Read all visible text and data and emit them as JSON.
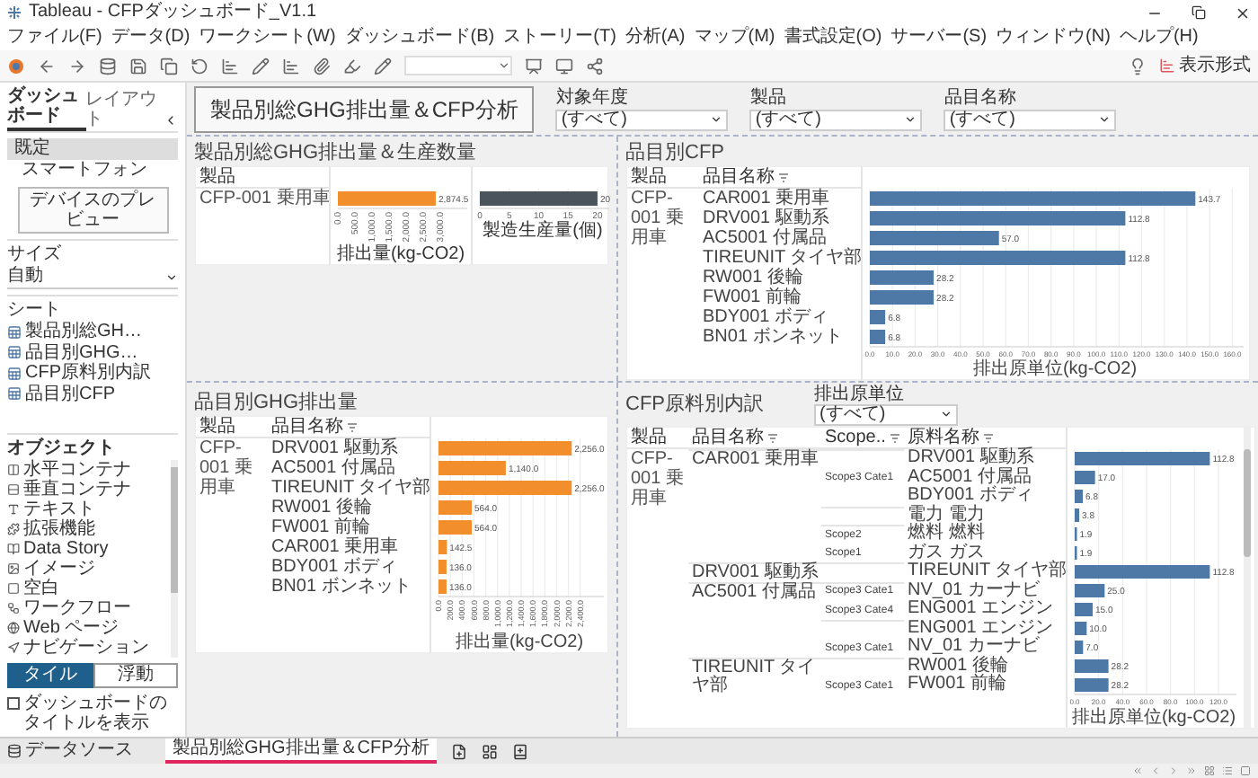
{
  "window": {
    "title": "Tableau - CFPダッシュボード_V1.1"
  },
  "menu": [
    "ファイル(F)",
    "データ(D)",
    "ワークシート(W)",
    "ダッシュボード(B)",
    "ストーリー(T)",
    "分析(A)",
    "マップ(M)",
    "書式設定(O)",
    "サーバー(S)",
    "ウィンドウ(N)",
    "ヘルプ(H)"
  ],
  "toolbar": {
    "format_button": "表示形式"
  },
  "left_panel": {
    "tabs": [
      {
        "label": "ダッシュボード",
        "selected": true
      },
      {
        "label": "レイアウト",
        "selected": false
      }
    ],
    "devices": [
      {
        "label": "既定",
        "selected": true
      },
      {
        "label": "スマートフォン",
        "selected": false
      }
    ],
    "preview_button": "デバイスのプレビュー",
    "size": {
      "title": "サイズ",
      "value": "自動"
    },
    "sheets": {
      "title": "シート",
      "items": [
        "製品別総GH…",
        "品目別GHG…",
        "CFP原料別内訳",
        "品目別CFP"
      ]
    },
    "objects": {
      "title": "オブジェクト",
      "items": [
        "水平コンテナ",
        "垂直コンテナ",
        "テキスト",
        "拡張機能",
        "Data Story",
        "イメージ",
        "空白",
        "ワークフロー",
        "Web ページ",
        "ナビゲーション"
      ]
    },
    "layout_mode": [
      {
        "label": "タイル",
        "selected": true
      },
      {
        "label": "浮動",
        "selected": false
      }
    ],
    "show_title": {
      "label": "ダッシュボードのタイトルを表示",
      "checked": false
    }
  },
  "dashboard": {
    "title": "製品別総GHG排出量＆CFP分析",
    "filters": [
      {
        "label": "対象年度",
        "value": "(すべて)"
      },
      {
        "label": "製品",
        "value": "(すべて)"
      },
      {
        "label": "品目名称",
        "value": "(すべて)"
      }
    ]
  },
  "product_ghg": {
    "title": "製品別総GHG排出量＆生産数量",
    "columns": [
      "製品"
    ],
    "emissions": {
      "chart_data": {
        "type": "bar",
        "orientation": "horizontal",
        "grid": false,
        "categories": [
          "CFP-001 乗用車"
        ],
        "series": [
          {
            "color": "#f28e2b",
            "values": [
              2874.5
            ]
          }
        ],
        "value_labels": [
          "2,874.5"
        ],
        "xlabel": "排出量(kg-CO2)",
        "xlim": [
          0,
          3800
        ],
        "xticks": [
          {
            "value": 0,
            "label": "0.0"
          },
          {
            "value": 500,
            "label": "500.0"
          },
          {
            "value": 1000,
            "label": "1,000.0"
          },
          {
            "value": 1500,
            "label": "1,500.0"
          },
          {
            "value": 2000,
            "label": "2,000.0"
          },
          {
            "value": 2500,
            "label": "2,500.0"
          },
          {
            "value": 3000,
            "label": "3,000.0"
          }
        ]
      }
    },
    "quantity": {
      "chart_data": {
        "type": "bar",
        "orientation": "horizontal",
        "grid": true,
        "series": [
          {
            "color": "#4b535c",
            "values": [
              20
            ]
          }
        ],
        "value_labels": [
          "20"
        ],
        "xlabel": "製造生産量(個)",
        "xlim": [
          0,
          22
        ],
        "xticks": [
          0,
          5,
          10,
          15,
          20
        ]
      }
    }
  },
  "item_cfp": {
    "title": "品目別CFP",
    "columns": [
      "製品",
      "品目名称"
    ],
    "product": "CFP-001 乗用車",
    "chart_data": {
      "type": "bar",
      "orientation": "horizontal",
      "grid": true,
      "categories": [
        "CAR001 乗用車",
        "DRV001 駆動系",
        "AC5001 付属品",
        "TIREUNIT タイヤ部",
        "RW001 後輪",
        "FW001 前輪",
        "BDY001 ボディ",
        "BN01 ボンネット"
      ],
      "series": [
        {
          "color": "#4e79a7",
          "values": [
            143.7,
            112.8,
            57.0,
            112.8,
            28.2,
            28.2,
            6.8,
            6.8
          ]
        }
      ],
      "value_labels": [
        "143.7",
        "112.8",
        "57.0",
        "112.8",
        "28.2",
        "28.2",
        "6.8",
        "6.8"
      ],
      "xlabel": "排出原単位(kg-CO2)",
      "xlim": [
        0,
        165
      ],
      "xticks": [
        {
          "value": 0,
          "label": "0.0"
        },
        {
          "value": 10,
          "label": "10.0"
        },
        {
          "value": 20,
          "label": "20.0"
        },
        {
          "value": 30,
          "label": "30.0"
        },
        {
          "value": 40,
          "label": "40.0"
        },
        {
          "value": 50,
          "label": "50.0"
        },
        {
          "value": 60,
          "label": "60.0"
        },
        {
          "value": 70,
          "label": "70.0"
        },
        {
          "value": 80,
          "label": "80.0"
        },
        {
          "value": 90,
          "label": "90.0"
        },
        {
          "value": 100,
          "label": "100.0"
        },
        {
          "value": 110,
          "label": "110.0"
        },
        {
          "value": 120,
          "label": "120.0"
        },
        {
          "value": 130,
          "label": "130.0"
        },
        {
          "value": 140,
          "label": "140.0"
        },
        {
          "value": 150,
          "label": "150.0"
        },
        {
          "value": 160,
          "label": "160.0"
        }
      ]
    }
  },
  "item_ghg": {
    "title": "品目別GHG排出量",
    "columns": [
      "製品",
      "品目名称"
    ],
    "product": "CFP-001 乗用車",
    "chart_data": {
      "type": "bar",
      "orientation": "horizontal",
      "grid": true,
      "categories": [
        "DRV001 駆動系",
        "AC5001 付属品",
        "TIREUNIT タイヤ部",
        "RW001 後輪",
        "FW001 前輪",
        "CAR001 乗用車",
        "BDY001 ボディ",
        "BN01 ボンネット"
      ],
      "series": [
        {
          "color": "#f28e2b",
          "values": [
            2256.0,
            1140.0,
            2256.0,
            564.0,
            564.0,
            142.5,
            136.0,
            136.0
          ]
        }
      ],
      "value_labels": [
        "2,256.0",
        "1,140.0",
        "2,256.0",
        "564.0",
        "564.0",
        "142.5",
        "136.0",
        "136.0"
      ],
      "xlabel": "排出量(kg-CO2)",
      "xlim": [
        0,
        2800
      ],
      "xticks": [
        {
          "value": 0,
          "label": "0.0"
        },
        {
          "value": 200,
          "label": "200.0"
        },
        {
          "value": 400,
          "label": "400.0"
        },
        {
          "value": 600,
          "label": "600.0"
        },
        {
          "value": 800,
          "label": "800.0"
        },
        {
          "value": 1000,
          "label": "1,000.0"
        },
        {
          "value": 1200,
          "label": "1,200.0"
        },
        {
          "value": 1400,
          "label": "1,400.0"
        },
        {
          "value": 1600,
          "label": "1,600.0"
        },
        {
          "value": 1800,
          "label": "1,800.0"
        },
        {
          "value": 2000,
          "label": "2,000.0"
        },
        {
          "value": 2200,
          "label": "2,200.0"
        },
        {
          "value": 2400,
          "label": "2,400.0"
        }
      ]
    }
  },
  "cfp_breakdown": {
    "title": "CFP原料別内訳",
    "filter": {
      "label": "排出原単位",
      "value": "(すべて)"
    },
    "columns": [
      "製品",
      "品目名称",
      "Scope..",
      "原料名称"
    ],
    "product": "CFP-001 乗用車",
    "items": [
      {
        "item": "CAR001 乗用車",
        "scopes": [
          {
            "scope": "Scope3 Cate1",
            "materials": [
              "DRV001 駆動系",
              "AC5001 付属品",
              "BDY001 ボディ"
            ]
          },
          {
            "scope": "Scope2",
            "materials": [
              "電力 電力"
            ]
          },
          {
            "scope": "Scope1",
            "materials": [
              "燃料 燃料",
              "ガス ガス"
            ]
          }
        ]
      },
      {
        "item": "DRV001 駆動系",
        "scopes": [
          {
            "scope": "Scope3 Cate1",
            "materials": [
              "TIREUNIT タイヤ部"
            ]
          }
        ]
      },
      {
        "item": "AC5001 付属品",
        "scopes": [
          {
            "scope": "Scope3 Cate4",
            "materials": [
              "NV_01 カーナビ",
              "ENG001 エンジン"
            ]
          },
          {
            "scope": "Scope3 Cate1",
            "materials": [
              "ENG001 エンジン",
              "NV_01 カーナビ"
            ]
          }
        ]
      },
      {
        "item": "TIREUNIT タイヤ部",
        "scopes": [
          {
            "scope": "Scope3 Cate1",
            "materials": [
              "RW001 後輪",
              "FW001 前輪"
            ]
          }
        ]
      }
    ],
    "chart_data": {
      "type": "bar",
      "orientation": "horizontal",
      "grid": true,
      "series": [
        {
          "color": "#4e79a7",
          "values": [
            112.8,
            17.0,
            6.8,
            3.8,
            1.9,
            1.9,
            112.8,
            25.0,
            15.0,
            10.0,
            7.0,
            28.2,
            28.2
          ]
        }
      ],
      "value_labels": [
        "112.8",
        "17.0",
        "6.8",
        "3.8",
        "1.9",
        "1.9",
        "112.8",
        "25.0",
        "15.0",
        "10.0",
        "7.0",
        "28.2",
        "28.2"
      ],
      "xlabel": "排出原単位(kg-CO2)",
      "xlim": [
        0,
        135
      ],
      "xticks": [
        {
          "value": 0,
          "label": "0.0"
        },
        {
          "value": 20,
          "label": "20.0"
        },
        {
          "value": 40,
          "label": "40.0"
        },
        {
          "value": 60,
          "label": "60.0"
        },
        {
          "value": 80,
          "label": "80.0"
        },
        {
          "value": 100,
          "label": "100.0"
        },
        {
          "value": 120,
          "label": "120.0"
        }
      ]
    }
  },
  "sheet_tabs": {
    "data_source": "データソース",
    "tabs": [
      {
        "label": "製品別総GHG排出量＆CFP分析",
        "selected": true
      }
    ]
  }
}
